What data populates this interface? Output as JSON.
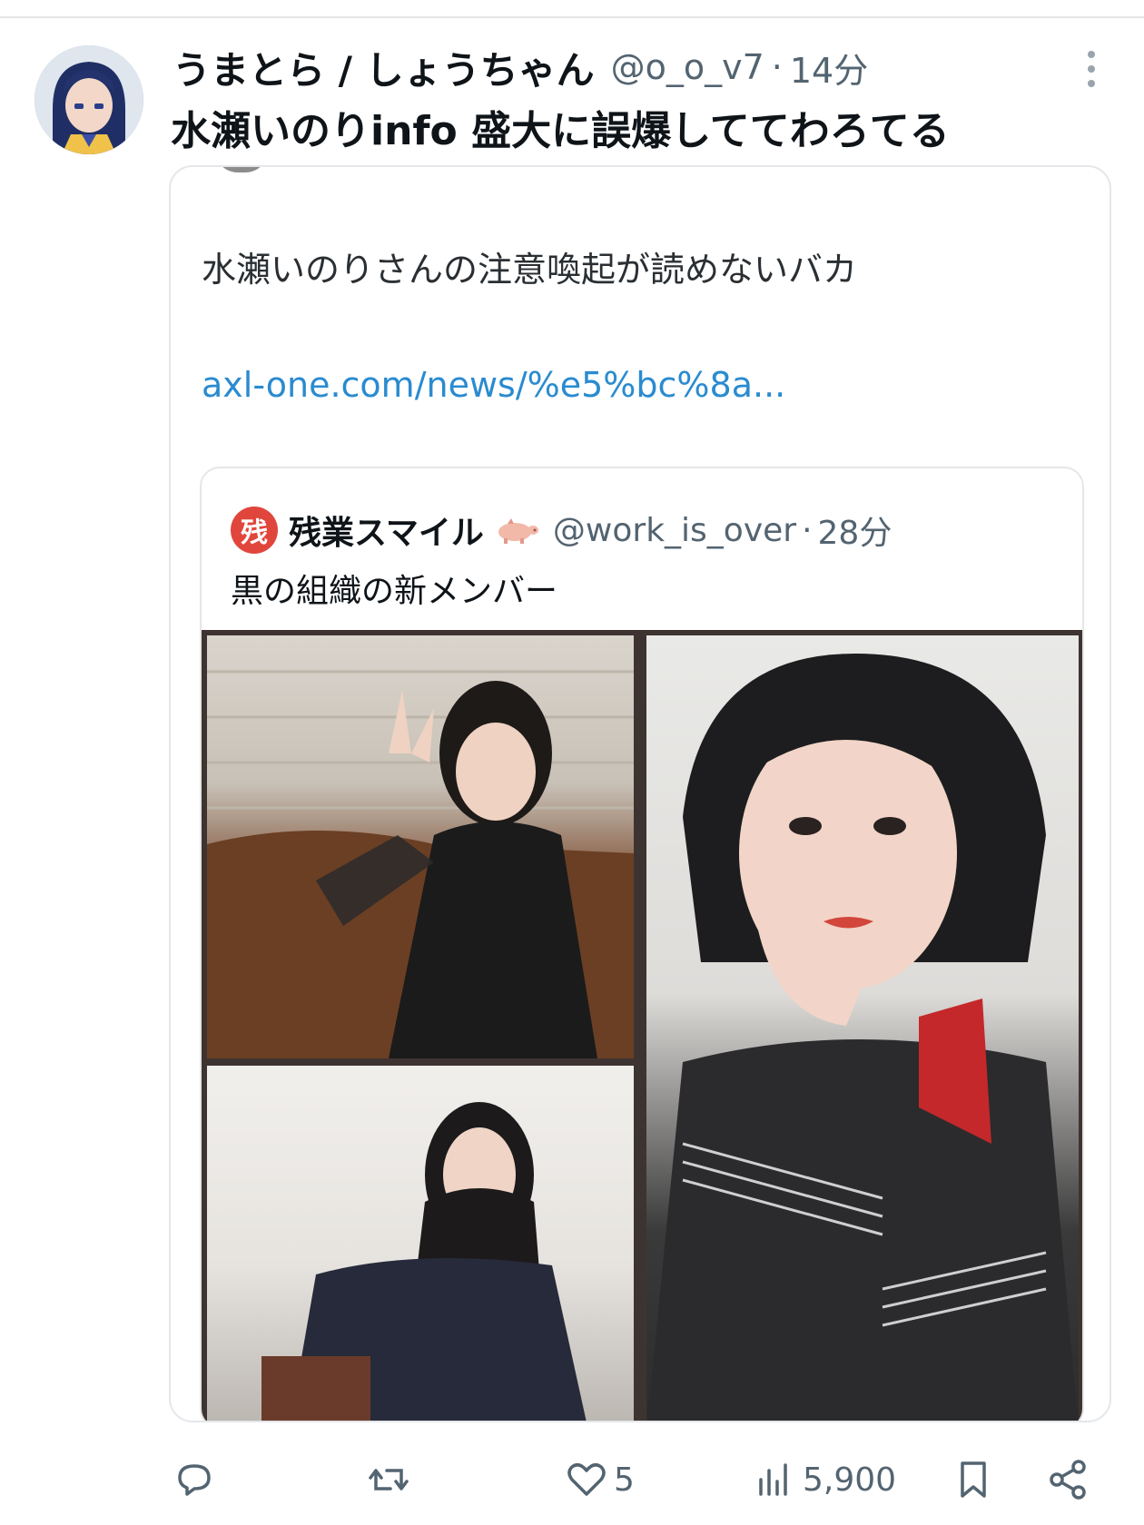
{
  "tweet": {
    "display_name": "うまとら / しょうちゃん",
    "handle": "@o_o_v7",
    "separator": "·",
    "time": "14分",
    "text": "水瀬いのりinfo 盛大に誤爆しててわろてる"
  },
  "quoted_tweet": {
    "text": "水瀬いのりさんの注意喚起が読めないバカ",
    "link": "axl-one.com/news/%e5%bc%8a..."
  },
  "inner_quote": {
    "logo_text": "残",
    "display_name": "残業スマイル",
    "handle": "@work_is_over",
    "separator": "·",
    "time": "28分",
    "text": "黒の組織の新メンバー"
  },
  "actions": {
    "reply": {
      "icon": "reply-icon"
    },
    "retweet": {
      "icon": "retweet-icon"
    },
    "like": {
      "icon": "heart-icon",
      "count": "5"
    },
    "views": {
      "icon": "views-icon",
      "count": "5,900"
    },
    "bookmark": {
      "icon": "bookmark-icon"
    },
    "share": {
      "icon": "share-icon"
    }
  },
  "colors": {
    "text_primary": "#0f1419",
    "text_secondary": "#536471",
    "link": "#2a8bd0",
    "logo_red": "#e0463c"
  }
}
